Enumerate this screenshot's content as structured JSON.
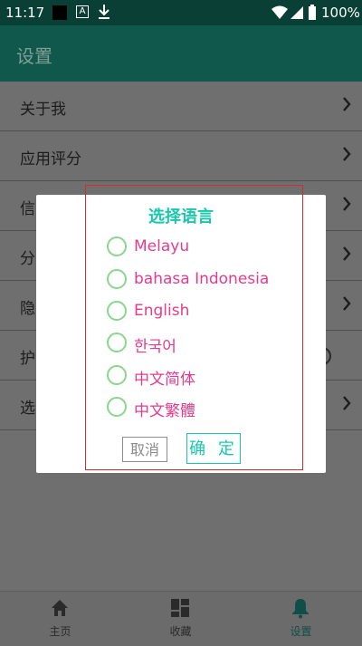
{
  "status_bar": {
    "time": "11:17",
    "battery_pct": "100%"
  },
  "app_bar": {
    "title": "设置"
  },
  "list": {
    "items": [
      {
        "label": "关于我"
      },
      {
        "label": "应用评分"
      },
      {
        "label": "信"
      },
      {
        "label": "分"
      },
      {
        "label": "隐"
      },
      {
        "label": "护"
      },
      {
        "label": "选"
      }
    ]
  },
  "dialog": {
    "title": "选择语言",
    "options": [
      {
        "label": "Melayu"
      },
      {
        "label": "bahasa Indonesia"
      },
      {
        "label": "English"
      },
      {
        "label": "한국어"
      },
      {
        "label": "中文简体"
      },
      {
        "label": "中文繁體"
      }
    ],
    "cancel": "取消",
    "confirm": "确 定"
  },
  "bottom_nav": {
    "items": [
      {
        "label": "主页"
      },
      {
        "label": "收藏"
      },
      {
        "label": "设置"
      }
    ],
    "active": "设置"
  },
  "colors": {
    "accent": "#19c7ad",
    "option_text": "#e43c8b",
    "radio": "#8bd68e"
  }
}
